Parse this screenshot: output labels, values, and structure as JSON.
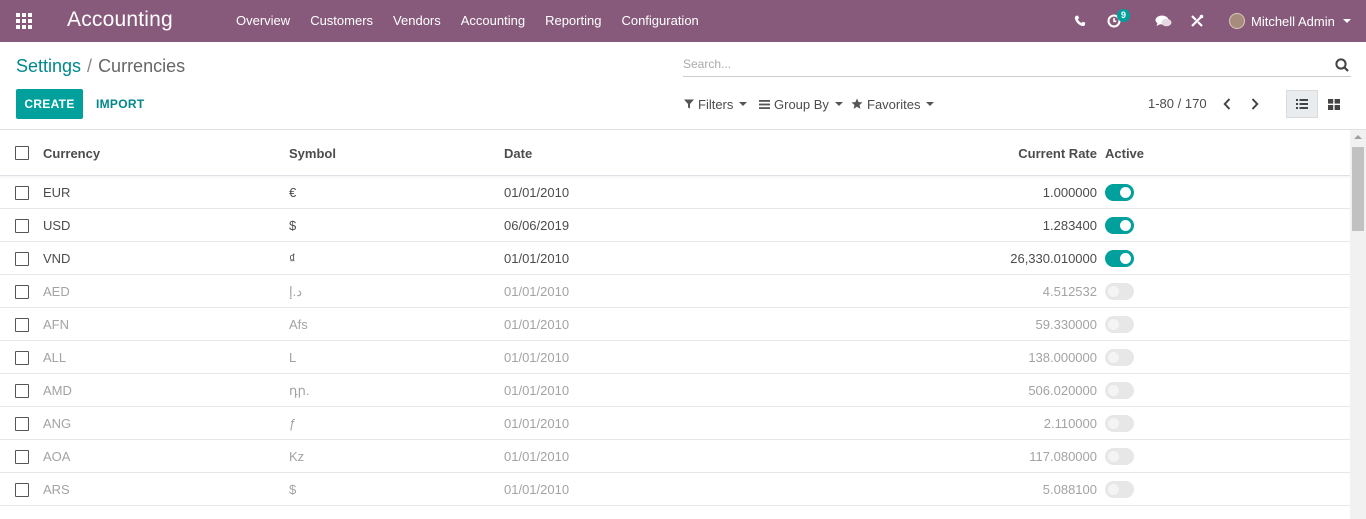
{
  "navbar": {
    "app_title": "Accounting",
    "menu": [
      "Overview",
      "Customers",
      "Vendors",
      "Accounting",
      "Reporting",
      "Configuration"
    ],
    "activity_count": "9",
    "user_name": "Mitchell Admin"
  },
  "breadcrumb": {
    "parent": "Settings",
    "separator": "/",
    "current": "Currencies"
  },
  "search": {
    "placeholder": "Search..."
  },
  "buttons": {
    "create": "CREATE",
    "import": "IMPORT"
  },
  "filters": {
    "filters": "Filters",
    "group_by": "Group By",
    "favorites": "Favorites"
  },
  "pager": {
    "value": "1-80 / 170"
  },
  "table": {
    "columns": {
      "currency": "Currency",
      "symbol": "Symbol",
      "date": "Date",
      "rate": "Current Rate",
      "active": "Active"
    },
    "rows": [
      {
        "currency": "EUR",
        "symbol": "€",
        "date": "01/01/2010",
        "rate": "1.000000",
        "active": true
      },
      {
        "currency": "USD",
        "symbol": "$",
        "date": "06/06/2019",
        "rate": "1.283400",
        "active": true
      },
      {
        "currency": "VND",
        "symbol": "₫",
        "date": "01/01/2010",
        "rate": "26,330.010000",
        "active": true
      },
      {
        "currency": "AED",
        "symbol": "د.إ",
        "date": "01/01/2010",
        "rate": "4.512532",
        "active": false
      },
      {
        "currency": "AFN",
        "symbol": "Afs",
        "date": "01/01/2010",
        "rate": "59.330000",
        "active": false
      },
      {
        "currency": "ALL",
        "symbol": "L",
        "date": "01/01/2010",
        "rate": "138.000000",
        "active": false
      },
      {
        "currency": "AMD",
        "symbol": "դր.",
        "date": "01/01/2010",
        "rate": "506.020000",
        "active": false
      },
      {
        "currency": "ANG",
        "symbol": "ƒ",
        "date": "01/01/2010",
        "rate": "2.110000",
        "active": false
      },
      {
        "currency": "AOA",
        "symbol": "Kz",
        "date": "01/01/2010",
        "rate": "117.080000",
        "active": false
      },
      {
        "currency": "ARS",
        "symbol": "$",
        "date": "01/01/2010",
        "rate": "5.088100",
        "active": false
      }
    ]
  },
  "colors": {
    "navbar": "#875a7b",
    "accent": "#00a09d",
    "link": "#00878c",
    "inactive_text": "#a3a3a3"
  }
}
